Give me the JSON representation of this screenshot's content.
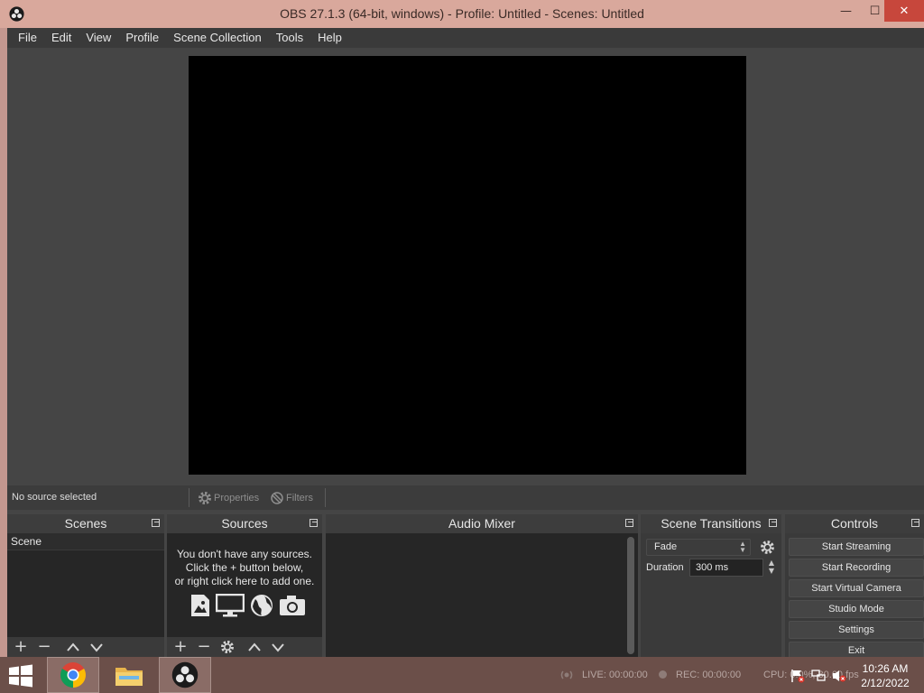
{
  "window": {
    "title": "OBS 27.1.3 (64-bit, windows) - Profile: Untitled - Scenes: Untitled",
    "min_glyph": "—",
    "max_glyph": "☐",
    "close_glyph": "✕"
  },
  "menu": [
    "File",
    "Edit",
    "View",
    "Profile",
    "Scene Collection",
    "Tools",
    "Help"
  ],
  "source_toolbar": {
    "status": "No source selected",
    "properties_label": "Properties",
    "filters_label": "Filters"
  },
  "docks": {
    "scenes": {
      "title": "Scenes",
      "items": [
        "Scene"
      ]
    },
    "sources": {
      "title": "Sources",
      "empty_line1": "You don't have any sources.",
      "empty_line2": "Click the + button below,",
      "empty_line3": "or right click here to add one."
    },
    "mixer": {
      "title": "Audio Mixer"
    },
    "transitions": {
      "title": "Scene Transitions",
      "selected": "Fade",
      "duration_label": "Duration",
      "duration_value": "300 ms"
    },
    "controls": {
      "title": "Controls",
      "buttons": [
        "Start Streaming",
        "Start Recording",
        "Start Virtual Camera",
        "Studio Mode",
        "Settings",
        "Exit"
      ]
    }
  },
  "statusbar": {
    "live": "LIVE: 00:00:00",
    "rec": "REC: 00:00:00",
    "cpu": "CPU: 0.0%, 30.00 fps"
  },
  "taskbar": {
    "time": "10:26 AM",
    "date": "2/12/2022"
  },
  "colors": {
    "panel": "#3a3a3a",
    "list_bg": "#262626",
    "preview": "#000000",
    "titlebar": "#d9a89c",
    "close_red": "#c7473c"
  }
}
